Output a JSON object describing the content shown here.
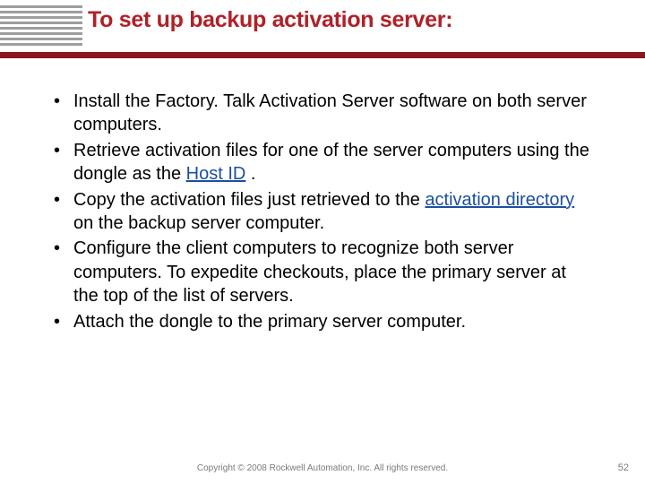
{
  "title": "To set up backup activation server:",
  "bullets": [
    {
      "pre": "Install the Factory. Talk Activation Server software on both server computers.",
      "link": "",
      "post": ""
    },
    {
      "pre": "Retrieve activation files for one of the server computers using the dongle as the ",
      "link": "Host ID",
      "post": " ."
    },
    {
      "pre": "Copy the activation files just retrieved to the ",
      "link": "activation directory",
      "post": " on the backup server computer."
    },
    {
      "pre": "Configure the client computers to recognize both server computers. To expedite checkouts, place the primary server at the top of the list of servers.",
      "link": "",
      "post": ""
    },
    {
      "pre": "Attach the dongle to the primary server computer.",
      "link": "",
      "post": ""
    }
  ],
  "footer": "Copyright © 2008 Rockwell Automation, Inc. All rights reserved.",
  "pagenum": "52"
}
